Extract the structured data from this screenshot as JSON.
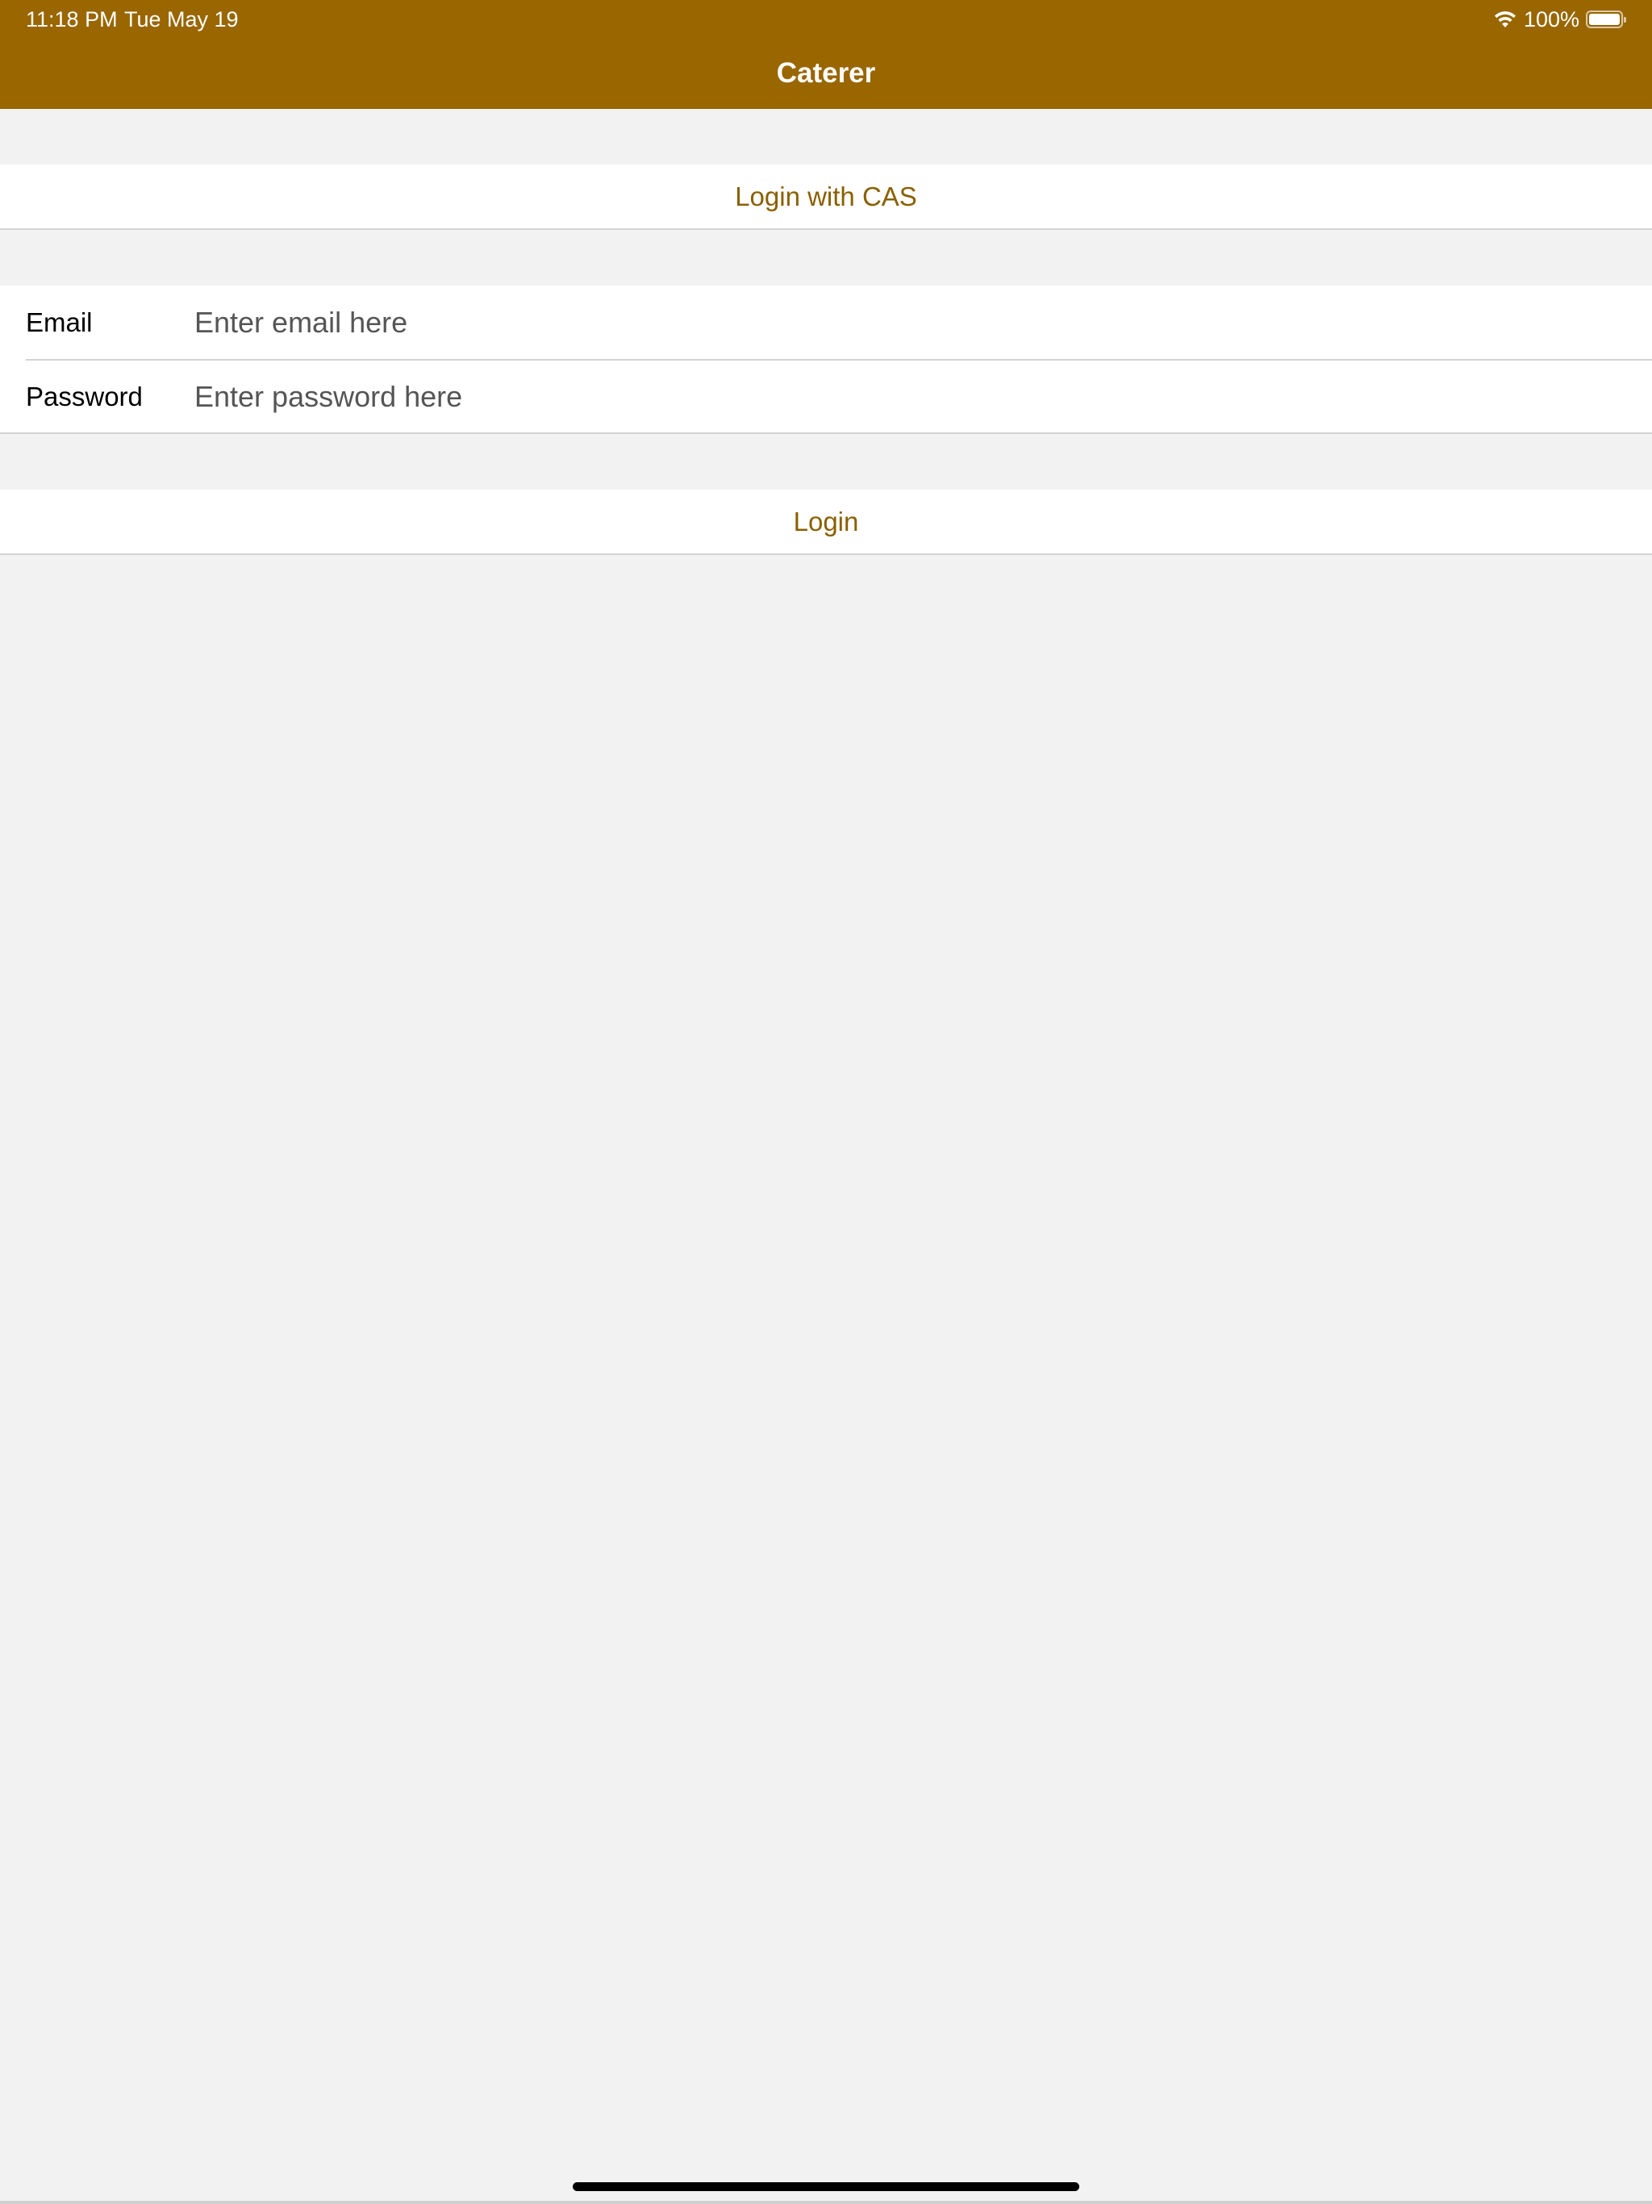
{
  "status_bar": {
    "time": "11:18 PM",
    "date": "Tue May 19",
    "battery": "100%",
    "icons": [
      "wifi-icon",
      "battery-icon"
    ]
  },
  "nav": {
    "title": "Caterer"
  },
  "cas_login": {
    "label": "Login with CAS"
  },
  "form": {
    "email": {
      "label": "Email",
      "placeholder": "Enter email here"
    },
    "password": {
      "label": "Password",
      "placeholder": "Enter password here"
    }
  },
  "login": {
    "label": "Login"
  },
  "colors": {
    "header_background": "#996600",
    "accent_text": "#8a6000",
    "page_background": "#f2f2f2"
  }
}
